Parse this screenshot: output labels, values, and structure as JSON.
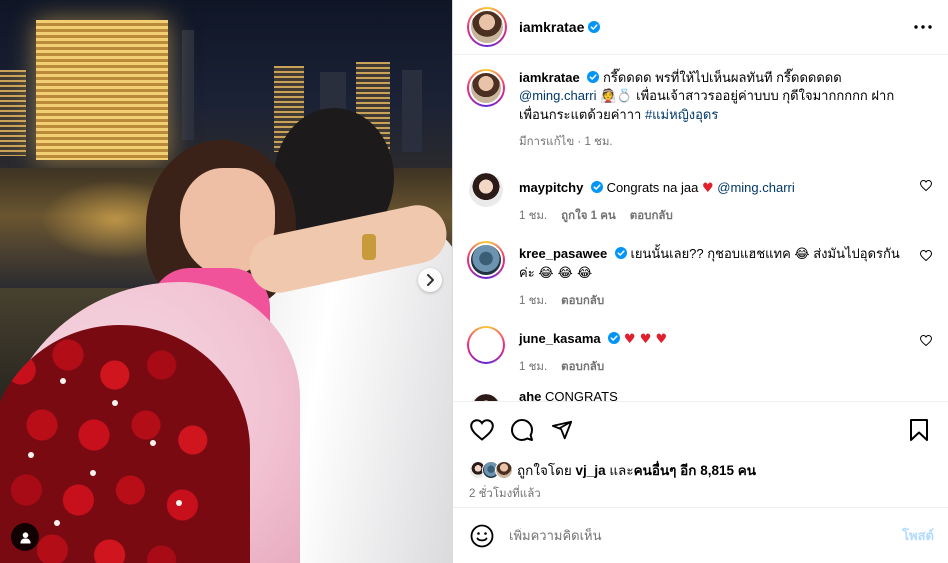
{
  "colors": {
    "accent": "#0095f6",
    "verified": "#0095f6",
    "mention": "#00376b",
    "muted": "#737373",
    "heart": "#e0202a",
    "post_disabled": "#b3dbff"
  },
  "media": {
    "next_icon": "chevron-right-icon",
    "tag_icon": "user-tag-icon"
  },
  "header": {
    "username": "iamkratae",
    "verified_icon": "verified-badge-icon",
    "more_icon": "more-options-icon"
  },
  "caption": {
    "username": "iamkratae",
    "line1": "กรี๊ดดดด พรที่ให้ไปเห็นผลทันที กรี๊ดดดดดด",
    "mention": "@ming.charri",
    "emoji": "👰💍",
    "line2": "เพื่อนเจ้าสาวรออยู่ค่าบบบ กุดีใจมากกกกก ฝาก",
    "line3": "เพื่อนกระแตด้วยค่าาา",
    "hashtag": "#แม่หญิงอุดร",
    "meta_edited": "มีการแก้ไข",
    "meta_time": "1 ชม."
  },
  "comments": [
    {
      "username": "maypitchy",
      "text": "Congrats na jaa",
      "heart": "♥",
      "mention": "@ming.charri",
      "time": "1 ชม.",
      "likes": "ถูกใจ 1 คน",
      "reply": "ตอบกลับ"
    },
    {
      "username": "kree_pasawee",
      "text_line1": "เยนนั้นเลย?? กุชอบแฮชแทค",
      "emoji1": "😂",
      "text_line1b": "ส่งมันไปอุดรกัน",
      "text_line2": "ค่ะ",
      "emoji2": "😂 😂 😂",
      "time": "1 ชม.",
      "reply": "ตอบกลับ"
    },
    {
      "username": "june_kasama",
      "hearts": "♥ ♥ ♥",
      "time": "1 ชม.",
      "reply": "ตอบกลับ"
    },
    {
      "username": "ahe",
      "text": "CONGRATS"
    }
  ],
  "actions": {
    "like_icon": "heart-icon",
    "comment_icon": "comment-icon",
    "share_icon": "send-icon",
    "save_icon": "bookmark-icon"
  },
  "likes": {
    "prefix": "ถูกใจโดย",
    "user": "vj_ja",
    "middle": "และ",
    "others": "คนอื่นๆ อีก 8,815 คน"
  },
  "posted": "2 ชั่วโมงที่แล้ว",
  "composer": {
    "emoji_icon": "emoji-smile-icon",
    "placeholder": "เพิ่มความคิดเห็น",
    "post_label": "โพสต์"
  }
}
